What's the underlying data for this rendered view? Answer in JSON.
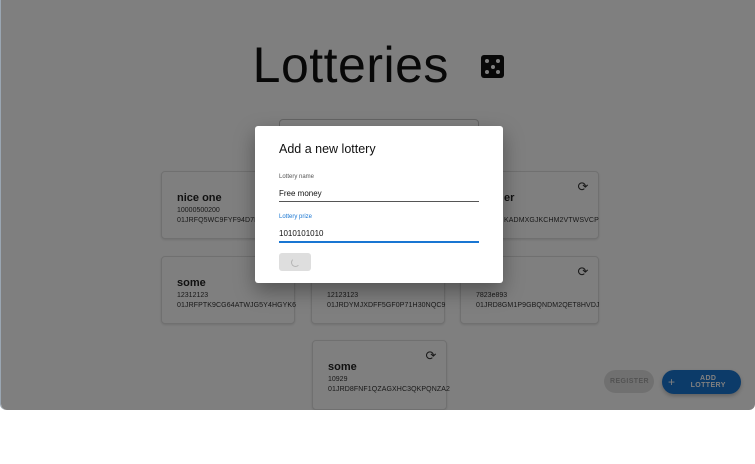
{
  "page": {
    "title": "Lotteries",
    "title_icon": "dice-icon"
  },
  "search": {
    "placeholder": ""
  },
  "lotteries": [
    {
      "name": "nice one",
      "prize": "10000500200",
      "id": "01JRFQ5WC9FYF94D7HC6J"
    },
    {
      "name": "er",
      "prize": "",
      "id": "KADMXGJKCHM2VTWSVCP"
    },
    {
      "name": "some",
      "prize": "12312123",
      "id": "01JRFPTK9CG64ATWJG5Y4HGYK6"
    },
    {
      "name": "",
      "prize": "12123123",
      "id": "01JRDYMJXDFF5GF0P71H30NQC9"
    },
    {
      "name": "",
      "prize": "7823e893",
      "id": "01JRD8GM1P9GBQNDM2QET8HVDJ"
    },
    {
      "name": "some",
      "prize": "10929",
      "id": "01JRD8FNF1QZAGXHC3QKPQNZA2"
    }
  ],
  "actions": {
    "register_label": "REGISTER",
    "add_lottery_label": "ADD LOTTERY",
    "add_icon": "plus-icon",
    "refresh_icon": "refresh-icon"
  },
  "dialog": {
    "title": "Add a new lottery",
    "name_label": "Lottery name",
    "name_value": "Free money",
    "prize_label": "Lottery prize",
    "prize_value": "1010101010",
    "submit_state": "loading",
    "submit_icon": "spinner-icon"
  },
  "colors": {
    "accent": "#1976d2",
    "backdrop": "rgba(0,0,0,0.5)",
    "disabled": "#e0e0e0"
  }
}
